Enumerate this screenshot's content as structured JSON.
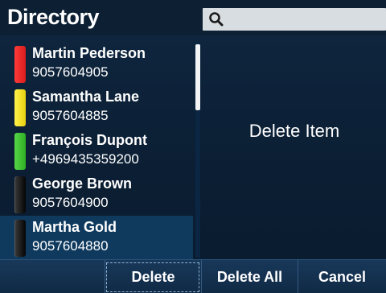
{
  "header": {
    "title": "Directory",
    "search": {
      "value": "",
      "icon": "search-icon"
    }
  },
  "contacts": [
    {
      "name": "Martin Pederson",
      "number": "9057604905",
      "status": "red"
    },
    {
      "name": "Samantha Lane",
      "number": "9057604885",
      "status": "yellow"
    },
    {
      "name": "François Dupont",
      "number": "+4969435359200",
      "status": "green"
    },
    {
      "name": "George Brown",
      "number": "9057604900",
      "status": "black"
    },
    {
      "name": "Martha Gold",
      "number": "9057604880",
      "status": "black",
      "selected": true
    }
  ],
  "detail": {
    "label": "Delete Item"
  },
  "softkeys": {
    "empty": "",
    "delete": "Delete",
    "delete_all": "Delete All",
    "cancel": "Cancel"
  },
  "colors": {
    "background": "#0e2238",
    "search_bg": "#d8dde2",
    "status_red": "#e02a2a",
    "status_yellow": "#f2e21e",
    "status_green": "#40c534",
    "status_black": "#1a1a1a",
    "selected_row": "#0f3a5e"
  }
}
